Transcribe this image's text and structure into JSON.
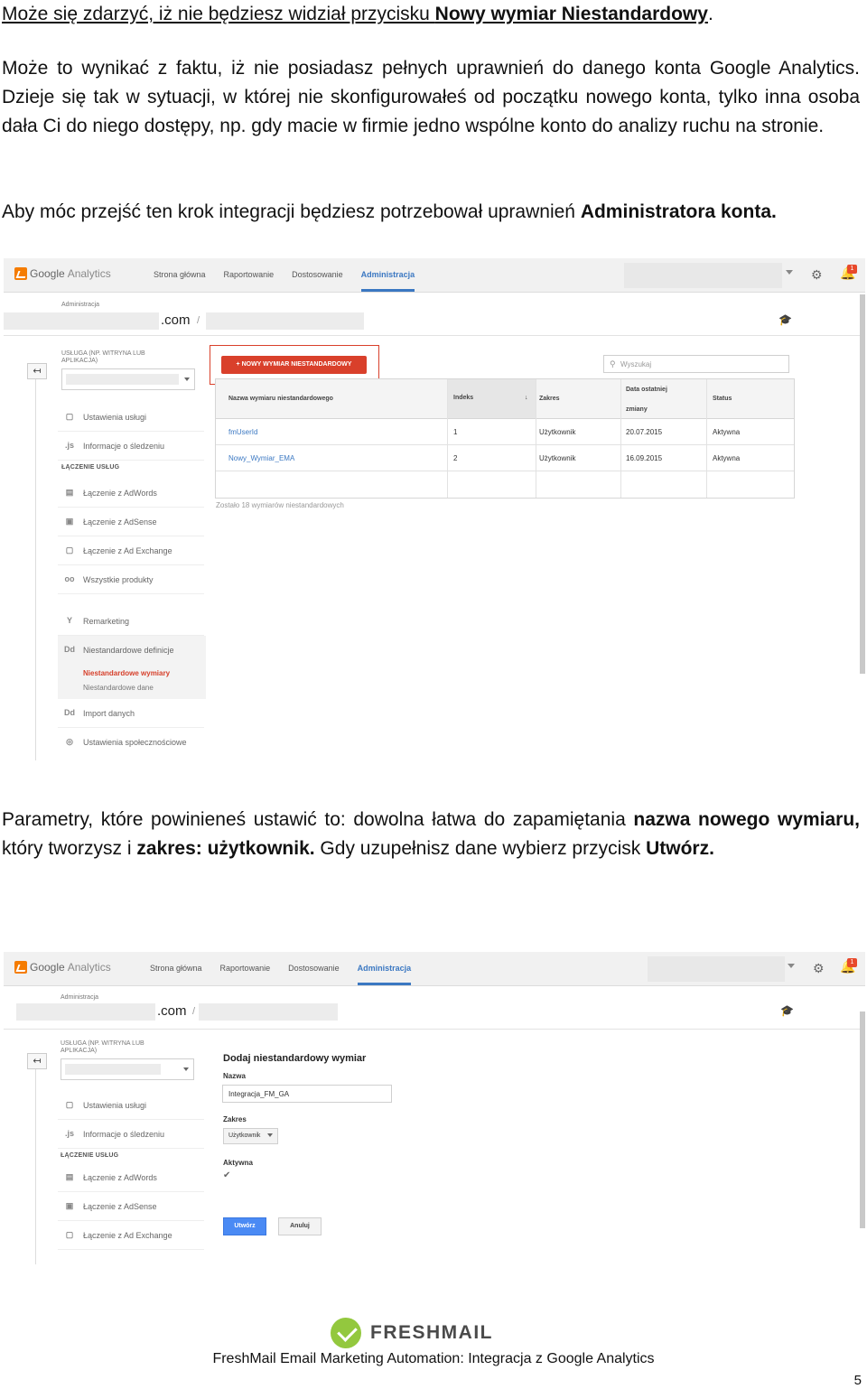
{
  "intro": {
    "p1_a": "Może się zdarzyć, iż nie będziesz widział przycisku ",
    "p1_b": "Nowy wymiar Niestandardowy",
    "p1_c": ".",
    "p2": "Może to wynikać z faktu, iż nie posiadasz pełnych uprawnień do danego konta Google Analytics. Dzieje się tak w sytuacji, w której nie skonfigurowałeś od początku nowego konta, tylko inna osoba dała Ci do niego dostępy, np. gdy macie w firmie jedno wspólne konto do analizy ruchu na stronie.",
    "p3_a": "Aby móc przejść ten krok integracji będziesz potrzebował uprawnień ",
    "p3_b": "Administratora konta."
  },
  "ga": {
    "logo_g": "Google",
    "logo_a": "Analytics",
    "nav": [
      "Strona główna",
      "Raportowanie",
      "Dostosowanie",
      "Administracja"
    ],
    "notification_count": "1",
    "breadcrumb_label": "Administracja",
    "domain_suffix": ".com",
    "domain_slash": "/",
    "service_label": "USŁUGA (NP. WITRYNA LUB APLIKACJA)",
    "side_top": [
      {
        "icon": "▢",
        "icon_name": "settings-page-icon",
        "label": "Ustawienia usługi"
      },
      {
        "icon": ".js",
        "icon_name": "js-icon",
        "label": "Informacje o śledzeniu"
      }
    ],
    "section_links": "ŁĄCZENIE USŁUG",
    "side_links": [
      {
        "icon": "▤",
        "icon_name": "adwords-icon",
        "label": "Łączenie z AdWords"
      },
      {
        "icon": "▣",
        "icon_name": "adsense-icon",
        "label": "Łączenie z AdSense"
      },
      {
        "icon": "▢",
        "icon_name": "adexchange-icon",
        "label": "Łączenie z Ad Exchange"
      },
      {
        "icon": "oo",
        "icon_name": "all-products-icon",
        "label": "Wszystkie produkty"
      }
    ],
    "side_bottom": {
      "remarketing": "Remarketing",
      "custom_defs": "Niestandardowe definicje",
      "custom_dims": "Niestandardowe wymiary",
      "custom_data": "Niestandardowe dane",
      "import_data": "Import danych",
      "social": "Ustawienia społecznościowe",
      "dd_icon": "Dd"
    }
  },
  "shot1": {
    "new_button": "+ NOWY WYMIAR NIESTANDARDOWY",
    "search_placeholder": "Wyszukaj",
    "table": {
      "headers": [
        "Nazwa wymiaru niestandardowego",
        "Indeks",
        "Zakres",
        "Data ostatniej",
        "zmiany",
        "Status"
      ],
      "rows": [
        [
          "fmUserId",
          "1",
          "Użytkownik",
          "20.07.2015",
          "Aktywna"
        ],
        [
          "Nowy_Wymiar_EMA",
          "2",
          "Użytkownik",
          "16.09.2015",
          "Aktywna"
        ]
      ]
    },
    "remaining": "Zostało 18 wymiarów niestandardowych"
  },
  "middle": {
    "a": "Parametry, które powinieneś ustawić to: dowolna łatwa do zapamiętania ",
    "b": "nazwa nowego wymiaru,",
    "c": " który tworzysz i ",
    "d": "zakres: użytkownik.",
    "e": " Gdy uzupełnisz dane wybierz przycisk ",
    "f": "Utwórz."
  },
  "shot2": {
    "form_title": "Dodaj niestandardowy wymiar",
    "name_label": "Nazwa",
    "name_value": "Integracja_FM_GA",
    "scope_label": "Zakres",
    "scope_value": "Użytkownik",
    "active_label": "Aktywna",
    "create": "Utwórz",
    "cancel": "Anuluj"
  },
  "footer": {
    "logo_word": "FRESHMAIL",
    "text": "FreshMail Email Marketing Automation: Integracja z Google Analytics",
    "page": "5"
  },
  "colors": {
    "ga_active": "#3b78c2",
    "ga_red": "#d9402b",
    "freshmail_green": "#93c83e",
    "ga_blue_btn": "#4a8af4"
  }
}
